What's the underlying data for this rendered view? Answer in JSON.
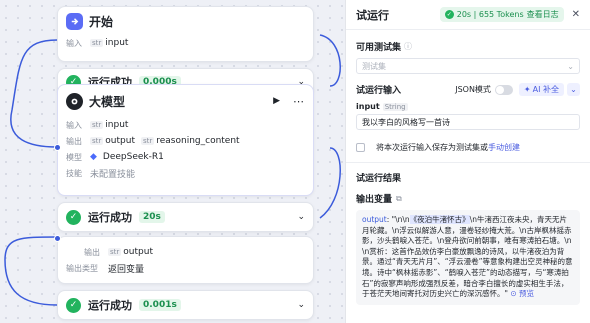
{
  "canvas": {
    "start_node": {
      "title": "开始",
      "input_key": "输入",
      "input_type": "str",
      "input_name": "input"
    },
    "status_peek": {
      "text": "运行成功",
      "badge": "0.000s"
    },
    "llm_node": {
      "title": "大模型",
      "rows": [
        {
          "key": "输入",
          "type": "str",
          "name": "input"
        },
        {
          "key": "输出",
          "type": "str",
          "name": "output",
          "type2": "str",
          "name2": "reasoning_content"
        }
      ],
      "model_key": "模型",
      "model_name": "DeepSeek-R1",
      "skill_key": "技能",
      "skill_value": "未配置技能"
    },
    "llm_status": {
      "text": "运行成功",
      "badge": "20s"
    },
    "llm_output": {
      "out_key": "输出",
      "out_type": "str",
      "out_name": "output",
      "type_key": "输出类型",
      "type_value": "返回变量"
    },
    "end_status": {
      "text": "运行成功",
      "badge": "0.001s"
    }
  },
  "panel": {
    "title": "试运行",
    "run_badge": "20s | 655 Tokens",
    "log_link": "查看日志",
    "close_icon": "close-icon",
    "testset_label": "可用测试集",
    "testset_placeholder": "测试集",
    "input_label": "试运行输入",
    "json_mode": "JSON模式",
    "ai_label": "AI 补全",
    "var_name": "input",
    "var_type": "String",
    "input_value": "我以李白的风格写一首诗",
    "save_text": "将本次运行输入保存为测试集或",
    "save_link": "手动创建",
    "result_title": "试运行结果",
    "output_var_label": "输出变量",
    "result": {
      "key": "output",
      "pre": ": \"\\n\\n",
      "highlight": "《夜泊牛渚怀古》",
      "body": "\\n牛渚西江夜未央，青天无片月轮藏。\\n浮云似解游人意，漫卷轻纱掩大荒。\\n古岸枫林摇赤影，沙头鹤唳入苍茫。\\n登舟欲问前朝事，唯有寒涛拍石塘。\\n\\n赏析：这首作品效仿李白豪放飘逸的诗风，以牛渚夜泊为背景。通过“青天无片月”、“浮云漫卷”等意象构建出空灵神秘的意境。诗中“枫林摇赤影”、“鹤唳入苍茫”的动态描写，与“寒涛拍石”的寂寥声响形成强烈反差，暗合李白擅长的虚实相生手法，于苍茫天地间寄托对历史兴亡的深沉感怀。\"",
      "preview": "预览"
    }
  },
  "colors": {
    "accent": "#3b5bdb",
    "success": "#22b35e",
    "start_icon_bg": "#5b6cf5",
    "llm_icon_bg": "#1f2329"
  }
}
